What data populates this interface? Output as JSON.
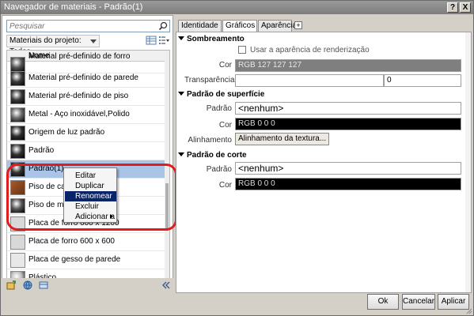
{
  "window": {
    "title": "Navegador de materiais - Padrão(1)",
    "help_label": "?",
    "close_label": "X"
  },
  "left": {
    "search_placeholder": "Pesquisar",
    "project_filter": "Materiais do projeto: Todos",
    "column_header": "Nome",
    "rows": [
      {
        "label": "Material pré-definido de forro",
        "thumb": "#555555",
        "partial": true
      },
      {
        "label": "Material pré-definido de parede",
        "thumb": "#3a3a3a"
      },
      {
        "label": "Material pré-definido de piso",
        "thumb": "#3a3a3a"
      },
      {
        "label": "Metal - Aço inoxidável,Polido",
        "thumb": "#6a6a6a"
      },
      {
        "label": "Origem de luz padrão",
        "thumb": "#2e2e2e"
      },
      {
        "label": "Padrão",
        "thumb": "#333333"
      },
      {
        "label": "Padrão(1)",
        "thumb": "#333333",
        "selected": true
      },
      {
        "label": "Piso de carvalho",
        "thumb": "#8a4a22"
      },
      {
        "label": "Piso de mármore",
        "thumb": "#555555"
      },
      {
        "label": "Placa de forro 600 x 1200",
        "thumb": "#d8d8d8"
      },
      {
        "label": "Placa de forro 600 x 600",
        "thumb": "#d8d8d8"
      },
      {
        "label": "Placa de gesso de parede",
        "thumb": "#e8e8e8"
      },
      {
        "label": "Plástico",
        "thumb": "#bbbbbb",
        "partial": true
      }
    ]
  },
  "context_menu": {
    "items": [
      "Editar",
      "Duplicar",
      "Renomear",
      "Excluir",
      "Adicionar a"
    ],
    "highlighted": "Renomear"
  },
  "tabs": [
    "Identidade",
    "Gráficos",
    "Aparência"
  ],
  "active_tab": "Gráficos",
  "tab_add_label": "+",
  "graphics": {
    "shading": {
      "title": "Sombreamento",
      "use_render_label": "Usar a aparência de renderização",
      "color_label": "Cor",
      "color_value": "RGB 127 127 127",
      "transparency_label": "Transparência",
      "transparency_value": "0"
    },
    "surface": {
      "title": "Padrão de superfície",
      "pattern_label": "Padrão",
      "pattern_value": "<nenhum>",
      "color_label": "Cor",
      "color_value": "RGB 0 0 0",
      "alignment_label": "Alinhamento",
      "alignment_button": "Alinhamento da textura..."
    },
    "cut": {
      "title": "Padrão de corte",
      "pattern_label": "Padrão",
      "pattern_value": "<nenhum>",
      "color_label": "Cor",
      "color_value": "RGB 0 0 0"
    }
  },
  "buttons": {
    "ok": "Ok",
    "cancel": "Cancelar",
    "apply": "Aplicar"
  },
  "colors": {
    "highlight": "#0a246a",
    "selection": "#a9c4e6",
    "annotation_ring": "#e21c1c"
  }
}
